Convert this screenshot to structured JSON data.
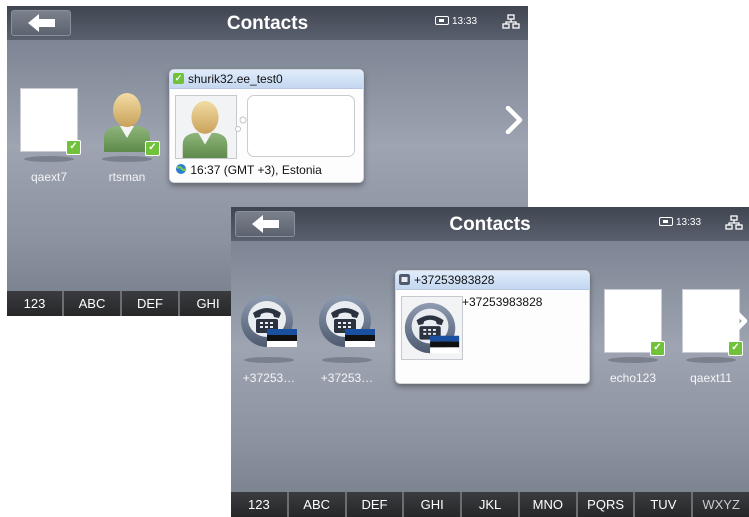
{
  "back_screen": {
    "title": "Contacts",
    "clock": "13:33",
    "contacts": [
      {
        "name": "qaext7",
        "status": "online"
      },
      {
        "name": "rtsman",
        "status": "online"
      }
    ],
    "detail_card": {
      "name": "shurik32.ee_test0",
      "status": "online",
      "time_text": "16:37 (GMT +3), Estonia"
    },
    "keys": [
      "123",
      "ABC",
      "DEF",
      "GHI"
    ]
  },
  "front_screen": {
    "title": "Contacts",
    "clock": "13:33",
    "contacts": [
      {
        "name": "+37253…",
        "type": "phone"
      },
      {
        "name": "+37253…",
        "type": "phone"
      },
      {
        "name": "echo123",
        "status": "online"
      },
      {
        "name": "qaext11",
        "status": "online"
      }
    ],
    "detail_card": {
      "number": "+37253983828",
      "number_label": "+37253983828"
    },
    "keys": [
      "123",
      "ABC",
      "DEF",
      "GHI",
      "JKL",
      "MNO",
      "PQRS",
      "TUV",
      "WXYZ"
    ]
  },
  "colors": {
    "accent_blue": "#c4d7f0",
    "online_green": "#6fc23a",
    "keybar": "#2e2f31"
  }
}
